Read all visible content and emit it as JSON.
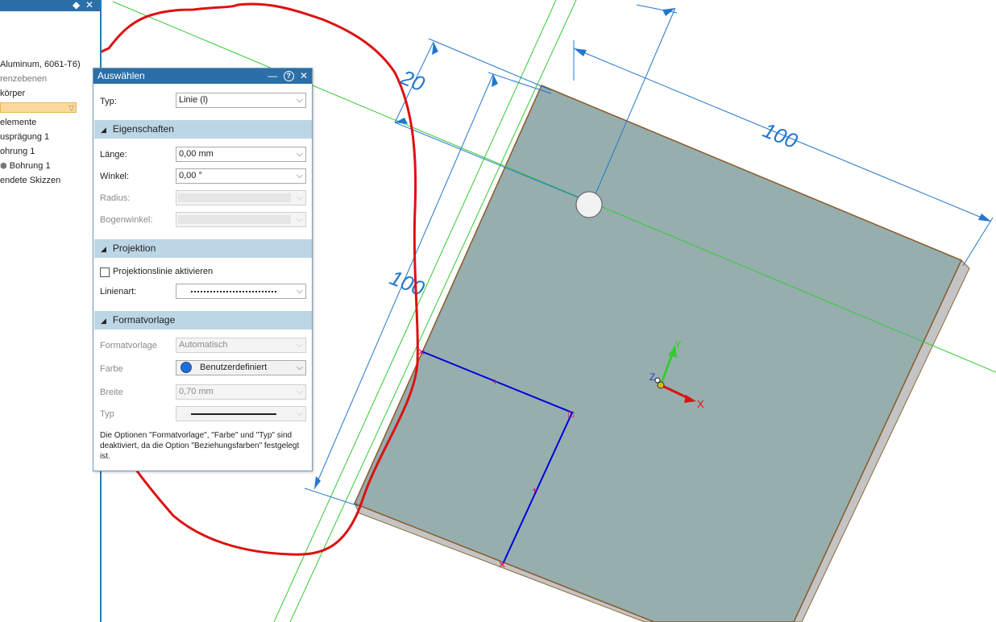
{
  "tree": {
    "items": [
      {
        "label": "Aluminum, 6061-T6)",
        "grey": false
      },
      {
        "label": "renzebenen",
        "grey": true
      },
      {
        "label": "körper",
        "grey": false
      },
      {
        "label": "elemente",
        "grey": false
      },
      {
        "label": "usprägung 1",
        "grey": false
      },
      {
        "label": "ohrung 1",
        "grey": false
      },
      {
        "label": "Bohrung 1",
        "grey": false
      },
      {
        "label": "endete Skizzen",
        "grey": false
      }
    ],
    "dropdown_value": ""
  },
  "panel": {
    "title": "Auswählen",
    "typ_label": "Typ:",
    "typ_value": "Linie (l)",
    "sections": {
      "eigenschaften": "Eigenschaften",
      "projektion": "Projektion",
      "formatvorlage": "Formatvorlage"
    },
    "laenge_label": "Länge:",
    "laenge_value": "0,00 mm",
    "winkel_label": "Winkel:",
    "winkel_value": "0,00 °",
    "radius_label": "Radius:",
    "bogenwinkel_label": "Bogenwinkel:",
    "projektionslinie_label": "Projektionslinie aktivieren",
    "projektionslinie_checked": false,
    "linienart_label": "Linienart:",
    "formatvorlage_label": "Formatvorlage",
    "formatvorlage_value": "Automatisch",
    "farbe_label": "Farbe",
    "farbe_value": "Benutzerdefiniert",
    "breite_label": "Breite",
    "breite_value": "0,70 mm",
    "typ2_label": "Typ",
    "note": "Die Optionen \"Formatvorlage\", \"Farbe\" und \"Typ\" sind deaktiviert, da die Option \"Beziehungsfarben\" festgelegt ist."
  },
  "canvas": {
    "dim_top": "100",
    "dim_left": "100",
    "dim_small": "20",
    "axis_x": "X",
    "axis_y": "Y",
    "axis_z": "Z"
  },
  "colors": {
    "plate": "#96aeae",
    "sketch_line": "#0000dd",
    "annotation": "#dd1111",
    "dimension": "#2277cc",
    "construction": "#33cc33"
  }
}
